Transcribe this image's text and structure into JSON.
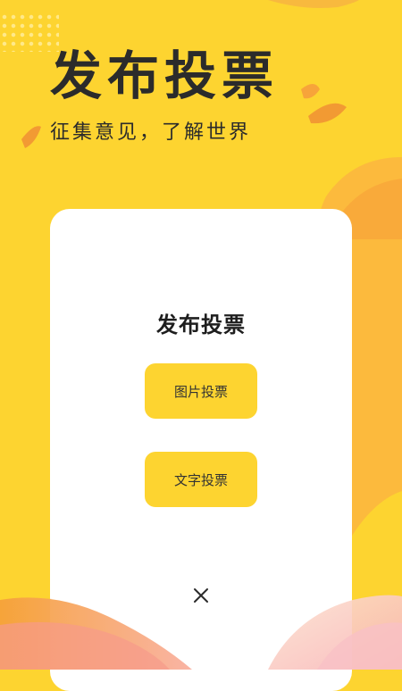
{
  "hero": {
    "title": "发布投票",
    "subtitle": "征集意见，了解世界"
  },
  "card": {
    "title": "发布投票",
    "buttons": {
      "image_vote": "图片投票",
      "text_vote": "文字投票"
    }
  },
  "icons": {
    "close": "close-icon",
    "decorations": [
      "dot-grid",
      "leaf-shape",
      "wave-blob"
    ]
  },
  "colors": {
    "background": "#FDD430",
    "button": "#FDD430",
    "card": "#FFFFFF",
    "text": "#2B2B2B",
    "accent_orange": "#F7A43A",
    "accent_pink": "#F9A9A0"
  }
}
